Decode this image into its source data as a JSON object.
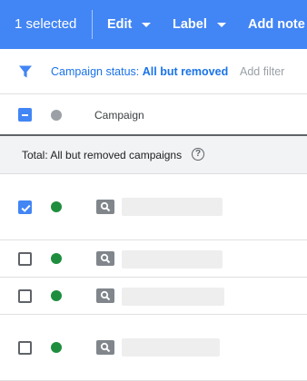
{
  "topbar": {
    "selected_text": "1 selected",
    "edit_label": "Edit",
    "label_label": "Label",
    "add_note_label": "Add note",
    "background_color": "#4285f4"
  },
  "filter": {
    "icon": "filter-funnel-icon",
    "status_prefix": "Campaign status: ",
    "status_value": "All but removed",
    "add_filter_label": "Add filter"
  },
  "table": {
    "header": {
      "select_all_state": "indeterminate",
      "status_column_icon": "grey-status-dot",
      "campaign_label": "Campaign"
    },
    "total": {
      "label": "Total: All but removed campaigns",
      "help_icon": "question-circle-icon",
      "help_symbol": "?"
    },
    "rows": [
      {
        "checked": true,
        "status": "enabled",
        "status_color": "#1e8e3e",
        "type_icon": "search-campaign-icon",
        "name": ""
      },
      {
        "checked": false,
        "status": "enabled",
        "status_color": "#1e8e3e",
        "type_icon": "search-campaign-icon",
        "name": ""
      },
      {
        "checked": false,
        "status": "enabled",
        "status_color": "#1e8e3e",
        "type_icon": "search-campaign-icon",
        "name": ""
      },
      {
        "checked": false,
        "status": "enabled",
        "status_color": "#1e8e3e",
        "type_icon": "search-campaign-icon",
        "name": ""
      }
    ]
  }
}
